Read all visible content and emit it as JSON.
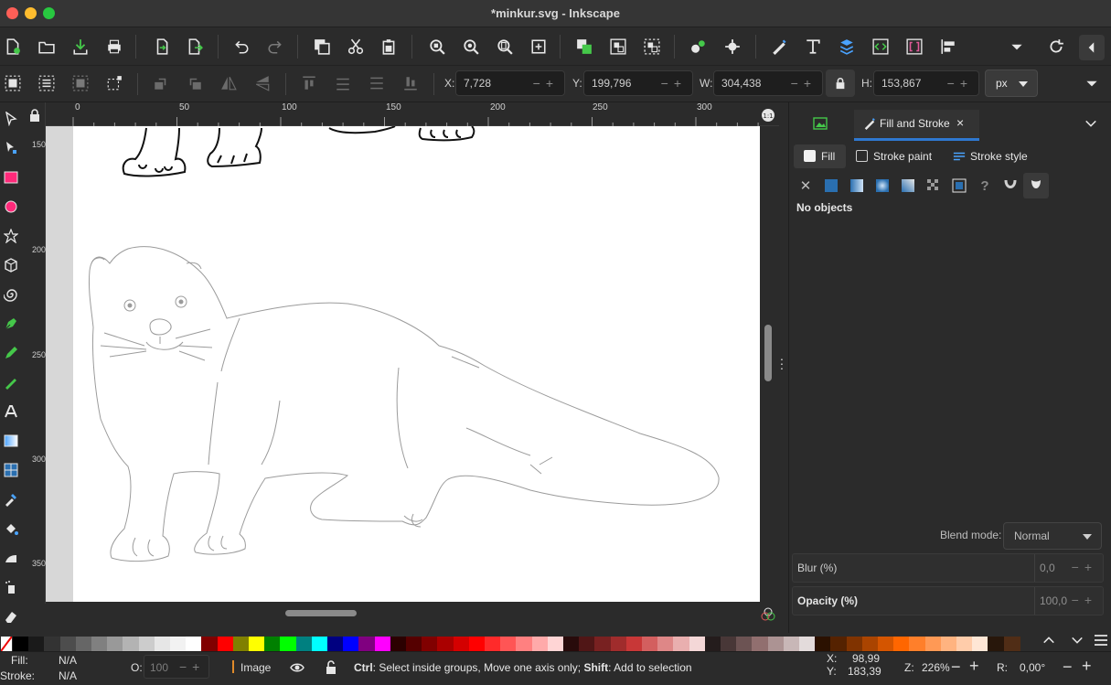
{
  "window": {
    "title": "*minkur.svg - Inkscape",
    "traffic_colors": [
      "#fe5f57",
      "#febc2e",
      "#28c840"
    ]
  },
  "commands_bar": {
    "icons": [
      "new-document",
      "open",
      "import",
      "print",
      "open-recent",
      "export",
      "undo",
      "redo",
      "duplicate",
      "cut",
      "paste",
      "zoom-selection",
      "zoom-drawing",
      "zoom-page",
      "zoom-center",
      "group",
      "ungroup",
      "raise",
      "object-properties",
      "node-distribute",
      "xml-editor",
      "fill-stroke",
      "text",
      "layers",
      "xml",
      "symbols",
      "align",
      "overflow-menu",
      "refresh",
      "collapse"
    ]
  },
  "tool_controls": {
    "x_label": "X:",
    "x_value": "7,728",
    "y_label": "Y:",
    "y_value": "199,796",
    "w_label": "W:",
    "w_value": "304,438",
    "h_label": "H:",
    "h_value": "153,867",
    "unit": "px"
  },
  "rulers": {
    "h_labels": [
      "0",
      "50",
      "100",
      "150",
      "200",
      "250",
      "300"
    ],
    "v_labels": [
      "150",
      "200",
      "250",
      "300",
      "350"
    ]
  },
  "dock": {
    "tab_label": "Fill and Stroke",
    "sub_tabs": {
      "fill": "Fill",
      "stroke_paint": "Stroke paint",
      "stroke_style": "Stroke style"
    },
    "no_objects": "No objects",
    "blend_label": "Blend mode:",
    "blend_value": "Normal",
    "blur_label": "Blur (%)",
    "blur_value": "0,0",
    "opacity_label": "Opacity (%)",
    "opacity_value": "100,0"
  },
  "palette": {
    "colors": [
      "#000000",
      "#1a1a1a",
      "#333333",
      "#4d4d4d",
      "#666666",
      "#808080",
      "#999999",
      "#b3b3b3",
      "#cccccc",
      "#e6e6e6",
      "#f2f2f2",
      "#ffffff",
      "#800000",
      "#ff0000",
      "#808000",
      "#ffff00",
      "#008000",
      "#00ff00",
      "#008080",
      "#00ffff",
      "#000080",
      "#0000ff",
      "#800080",
      "#ff00ff",
      "#2b0000",
      "#550000",
      "#800000",
      "#aa0000",
      "#d40000",
      "#ff0000",
      "#ff2a2a",
      "#ff5555",
      "#ff8080",
      "#ffaaaa",
      "#ffd5d5",
      "#280b0b",
      "#501616",
      "#782121",
      "#a02c2c",
      "#c83737",
      "#d35f5f",
      "#de8787",
      "#e9afaf",
      "#f4d7d7",
      "#241c1c",
      "#483737",
      "#6c5353",
      "#916f6f",
      "#ac9393",
      "#c8b7b7",
      "#e3dbdb",
      "#2b1100",
      "#552200",
      "#803300",
      "#aa4400",
      "#d45500",
      "#ff6600",
      "#ff7f2a",
      "#ff9955",
      "#ffb380",
      "#ffccaa",
      "#ffe6d5",
      "#28170b",
      "#502d16"
    ]
  },
  "status_bar": {
    "fill_label": "Fill:",
    "fill_value": "N/A",
    "stroke_label": "Stroke:",
    "stroke_value": "N/A",
    "opacity_label": "O:",
    "opacity_value": "100",
    "layer_name": "Image",
    "hint_bold1": "Ctrl",
    "hint_text1": ": Select inside groups, Move one axis only; ",
    "hint_bold2": "Shift",
    "hint_text2": ": Add to selection",
    "cursor_x_label": "X:",
    "cursor_x": "98,99",
    "cursor_y_label": "Y:",
    "cursor_y": "183,39",
    "zoom_label": "Z:",
    "zoom_value": "226%",
    "rotation_label": "R:",
    "rotation_value": "0,00°"
  }
}
